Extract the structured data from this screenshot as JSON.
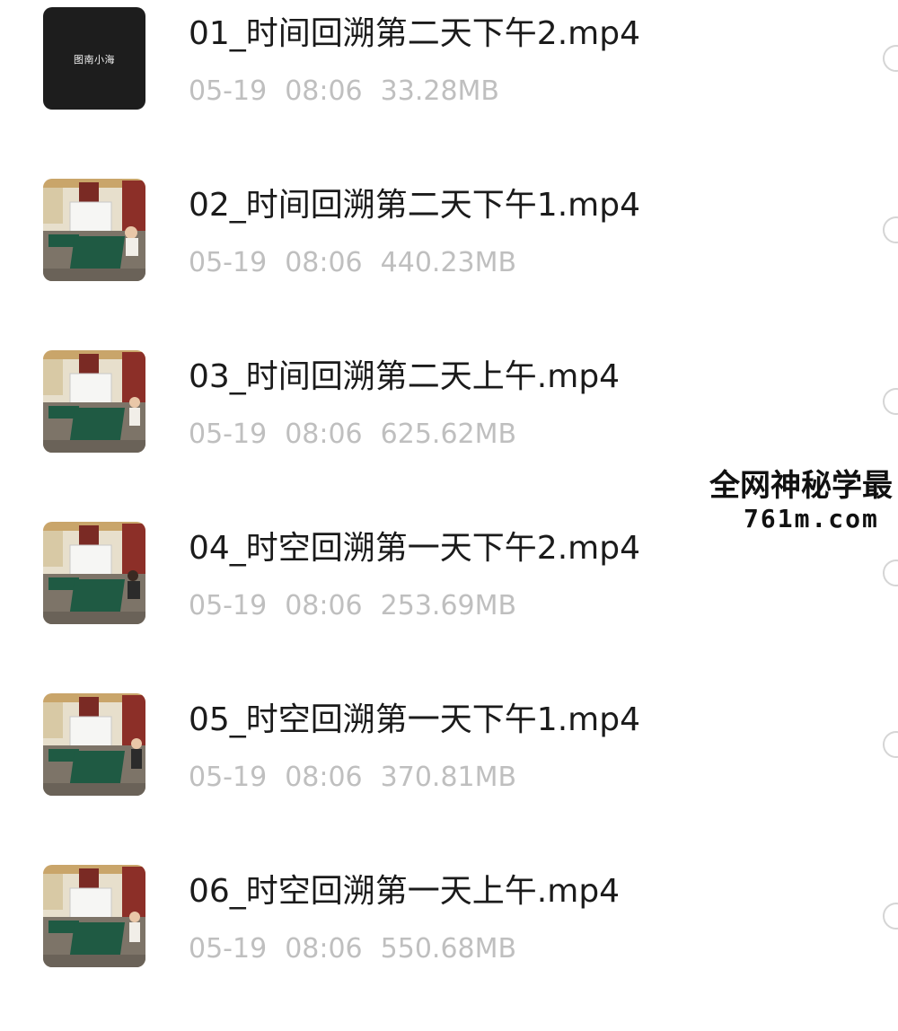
{
  "files": [
    {
      "name": "01_时间回溯第二天下午2.mp4",
      "date": "05-19",
      "time": "08:06",
      "size": "33.28MB",
      "thumbnail": "dark-logo",
      "thumbnail_text": "图南小海"
    },
    {
      "name": "02_时间回溯第二天下午1.mp4",
      "date": "05-19",
      "time": "08:06",
      "size": "440.23MB",
      "thumbnail": "classroom-photo"
    },
    {
      "name": "03_时间回溯第二天上午.mp4",
      "date": "05-19",
      "time": "08:06",
      "size": "625.62MB",
      "thumbnail": "classroom-photo"
    },
    {
      "name": "04_时空回溯第一天下午2.mp4",
      "date": "05-19",
      "time": "08:06",
      "size": "253.69MB",
      "thumbnail": "classroom-photo"
    },
    {
      "name": "05_时空回溯第一天下午1.mp4",
      "date": "05-19",
      "time": "08:06",
      "size": "370.81MB",
      "thumbnail": "classroom-photo"
    },
    {
      "name": "06_时空回溯第一天上午.mp4",
      "date": "05-19",
      "time": "08:06",
      "size": "550.68MB",
      "thumbnail": "classroom-photo"
    }
  ],
  "watermark": {
    "line1": "全网神秘学最",
    "line2": "761m.com"
  },
  "colors": {
    "file_name": "#1b1b1b",
    "file_meta": "#bfbfbf",
    "select_circle_border": "#d5d5d5",
    "dark_thumbnail": "#1d1d1d"
  }
}
